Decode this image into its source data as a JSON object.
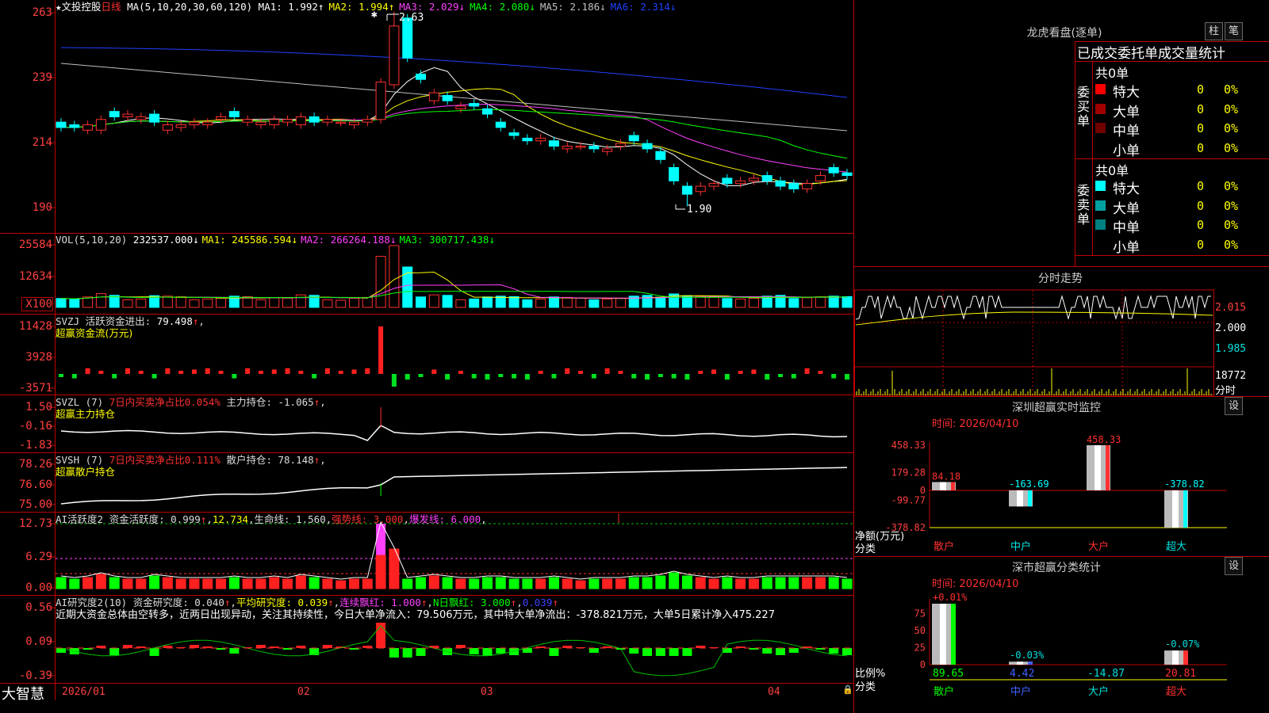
{
  "main": {
    "title_star": "★",
    "stock_name": "文投控股",
    "period": "日线",
    "ma_header": {
      "label": "MA(5,10,20,30,60,120)",
      "items": [
        {
          "text": "MA1: 1.992↑",
          "color": "#ffffff"
        },
        {
          "text": "MA2: 1.994↑",
          "color": "#ffff00"
        },
        {
          "text": "MA3: 2.029↓",
          "color": "#ff40ff"
        },
        {
          "text": "MA4: 2.080↓",
          "color": "#00ff00"
        },
        {
          "text": "MA5: 2.186↓",
          "color": "#c0c0c0"
        },
        {
          "text": "MA6: 2.314↓",
          "color": "#2040ff"
        }
      ]
    },
    "y_ticks": [
      "263",
      "239",
      "214",
      "190"
    ],
    "high_label": "2.63",
    "low_label": "1.90"
  },
  "vol": {
    "header_label": "VOL(5,10,20)",
    "items": [
      {
        "text": "232537.000↓",
        "color": "#ffffff"
      },
      {
        "text": "MA1: 245586.594↓",
        "color": "#ffff00"
      },
      {
        "text": "MA2: 266264.188↓",
        "color": "#ff40ff"
      },
      {
        "text": "MA3: 300717.438↓",
        "color": "#00ff00"
      }
    ],
    "y_ticks": [
      "25584",
      "12634",
      "X100"
    ]
  },
  "svzj": {
    "line1": [
      {
        "text": "SVZJ  活跃资金进出: ",
        "color": "#dddddd"
      },
      {
        "text": "79.498",
        "color": "#ffffff"
      },
      {
        "text": "↑",
        "color": "#ff3030"
      },
      {
        "text": ",",
        "color": "#dddddd"
      }
    ],
    "line2": "超赢资金流(万元)",
    "y_ticks": [
      "11428",
      "3928",
      "-3571"
    ]
  },
  "svzl": {
    "line1": [
      {
        "text": "SVZL (7) ",
        "color": "#dddddd"
      },
      {
        "text": "7日内买卖净占比0.054%",
        "color": "#ff3030"
      },
      {
        "text": " 主力持仓: -1.065",
        "color": "#dddddd"
      },
      {
        "text": "↑",
        "color": "#ff3030"
      },
      {
        "text": ",",
        "color": "#dddddd"
      }
    ],
    "line2": "超赢主力持仓",
    "y_ticks": [
      "1.50",
      "-0.16",
      "-1.83"
    ]
  },
  "svsh": {
    "line1": [
      {
        "text": "SVSH (7) ",
        "color": "#dddddd"
      },
      {
        "text": "7日内买卖净占比0.111%",
        "color": "#ff3030"
      },
      {
        "text": " 散户持仓: 78.148",
        "color": "#dddddd"
      },
      {
        "text": "↑",
        "color": "#ff3030"
      },
      {
        "text": ",",
        "color": "#dddddd"
      }
    ],
    "line2": "超赢散户持仓",
    "y_ticks": [
      "78.26",
      "76.60",
      "75.00"
    ]
  },
  "ai_active": {
    "line1": [
      {
        "text": "AI活跃度2 资金活跃度: 0.999",
        "color": "#dddddd"
      },
      {
        "text": "↑",
        "color": "#ff3030"
      },
      {
        "text": ",",
        "color": "#dddddd"
      },
      {
        "text": "12.734",
        "color": "#ffff00"
      },
      {
        "text": ",",
        "color": "#dddddd"
      },
      {
        "text": "生命线: 1.560",
        "color": "#dddddd"
      },
      {
        "text": ",",
        "color": "#dddddd"
      },
      {
        "text": "强势线: 3.000",
        "color": "#ff3030"
      },
      {
        "text": ",",
        "color": "#dddddd"
      },
      {
        "text": "爆发线: 6.000",
        "color": "#ff40ff"
      },
      {
        "text": ",",
        "color": "#dddddd"
      }
    ],
    "y_ticks": [
      "12.73",
      "6.29",
      "0.00"
    ]
  },
  "ai_research": {
    "line1": [
      {
        "text": "AI研究度2(10) 资金研究度: 0.040",
        "color": "#dddddd"
      },
      {
        "text": "↑",
        "color": "#ff3030"
      },
      {
        "text": ",",
        "color": "#dddddd"
      },
      {
        "text": "平均研究度: 0.039",
        "color": "#ffff00"
      },
      {
        "text": "↑",
        "color": "#ff3030"
      },
      {
        "text": ",",
        "color": "#dddddd"
      },
      {
        "text": "连续飘红: 1.000",
        "color": "#ff40ff"
      },
      {
        "text": "↑",
        "color": "#ff3030"
      },
      {
        "text": ",",
        "color": "#dddddd"
      },
      {
        "text": "N日飘红: 3.000",
        "color": "#00ff00"
      },
      {
        "text": "↑",
        "color": "#ff3030"
      },
      {
        "text": ",",
        "color": "#dddddd"
      },
      {
        "text": "0.039",
        "color": "#4040ff"
      },
      {
        "text": "↑",
        "color": "#ff3030"
      }
    ],
    "line2": "近期大资金总体由空转多，近两日出现异动，关注其持续性，今日大单净流入：79.506万元，其中特大单净流出：-378.821万元，大单5日累计净入475.227",
    "y_ticks": [
      "0.56",
      "0.09",
      "-0.39"
    ]
  },
  "bottom": {
    "brand": "大智慧",
    "dates": [
      "2026/01",
      "02",
      "03",
      "04"
    ]
  },
  "dragon": {
    "title": "龙虎看盘(逐单)",
    "btn_zhu": "柱",
    "btn_bi": "笔",
    "subtitle": "已成交委托单成交量统计",
    "buy_side": "委买单",
    "sell_side": "委卖单",
    "buy_total": "共0单",
    "sell_total": "共0单",
    "buy_rows": [
      {
        "label": "特大",
        "val": "0",
        "pct": "0%",
        "color": "#ff0000"
      },
      {
        "label": "大单",
        "val": "0",
        "pct": "0%",
        "color": "#a00000"
      },
      {
        "label": "中单",
        "val": "0",
        "pct": "0%",
        "color": "#700000"
      },
      {
        "label": "小单",
        "val": "0",
        "pct": "0%",
        "color": ""
      }
    ],
    "sell_rows": [
      {
        "label": "特大",
        "val": "0",
        "pct": "0%",
        "color": "#00ffff"
      },
      {
        "label": "大单",
        "val": "0",
        "pct": "0%",
        "color": "#00a0a0"
      },
      {
        "label": "中单",
        "val": "0",
        "pct": "0%",
        "color": "#008080"
      },
      {
        "label": "小单",
        "val": "0",
        "pct": "0%",
        "color": ""
      }
    ]
  },
  "intraday": {
    "title": "分时走势",
    "prices": [
      "2.015",
      "2.000",
      "1.985"
    ],
    "volume": "18772",
    "vol_label": "分时"
  },
  "sz_monitor": {
    "title": "深圳超赢实时监控",
    "btn": "设",
    "time": "时间: 2026/04/10",
    "y_ticks": [
      "458.33",
      "179.28",
      "0",
      "-99.77",
      "-378.82"
    ],
    "y_label_1": "净额(万元)",
    "y_label_2": "分类",
    "categories": [
      "散户",
      "中户",
      "大户",
      "超大"
    ],
    "values": [
      84.18,
      -163.69,
      458.33,
      -378.82
    ],
    "value_labels": [
      "84.18",
      "-163.69",
      "458.33",
      "-378.82"
    ]
  },
  "sz_class": {
    "title": "深市超赢分类统计",
    "btn": "设",
    "time": "时间: 2026/04/10",
    "y_ticks": [
      "75",
      "50",
      "25",
      "0"
    ],
    "y_label_1": "比例%",
    "y_label_2": "分类",
    "categories": [
      "散户",
      "中户",
      "大户",
      "超大"
    ],
    "values": [
      89.65,
      4.42,
      -14.87,
      20.81
    ],
    "value_labels": [
      "89.65",
      "4.42",
      "-14.87",
      "20.81"
    ],
    "change_labels": [
      "+0.01%",
      "-0.03%",
      "",
      "-0.07%"
    ]
  },
  "chart_data": [
    {
      "type": "candlestick",
      "series": [
        {
          "name": "MA1",
          "value": 1.992
        },
        {
          "name": "MA2",
          "value": 1.994
        },
        {
          "name": "MA3",
          "value": 2.029
        },
        {
          "name": "MA4",
          "value": 2.08
        },
        {
          "name": "MA5",
          "value": 2.186
        },
        {
          "name": "MA6",
          "value": 2.314
        }
      ],
      "y_ticks": [
        "263",
        "239",
        "214",
        "190"
      ],
      "x": [
        "2026/01",
        "02",
        "03",
        "04"
      ],
      "annotations": [
        "2.63",
        "1.90"
      ]
    },
    {
      "type": "bar",
      "categories": [
        "散户",
        "中户",
        "大户",
        "超大"
      ],
      "values": [
        84.18,
        -163.69,
        458.33,
        -378.82
      ],
      "title": "深圳超赢实时监控",
      "ylabel": "净额(万元)"
    },
    {
      "type": "bar",
      "categories": [
        "散户",
        "中户",
        "大户",
        "超大"
      ],
      "values": [
        89.65,
        4.42,
        -14.87,
        20.81
      ],
      "title": "深市超赢分类统计",
      "ylabel": "比例%"
    }
  ]
}
